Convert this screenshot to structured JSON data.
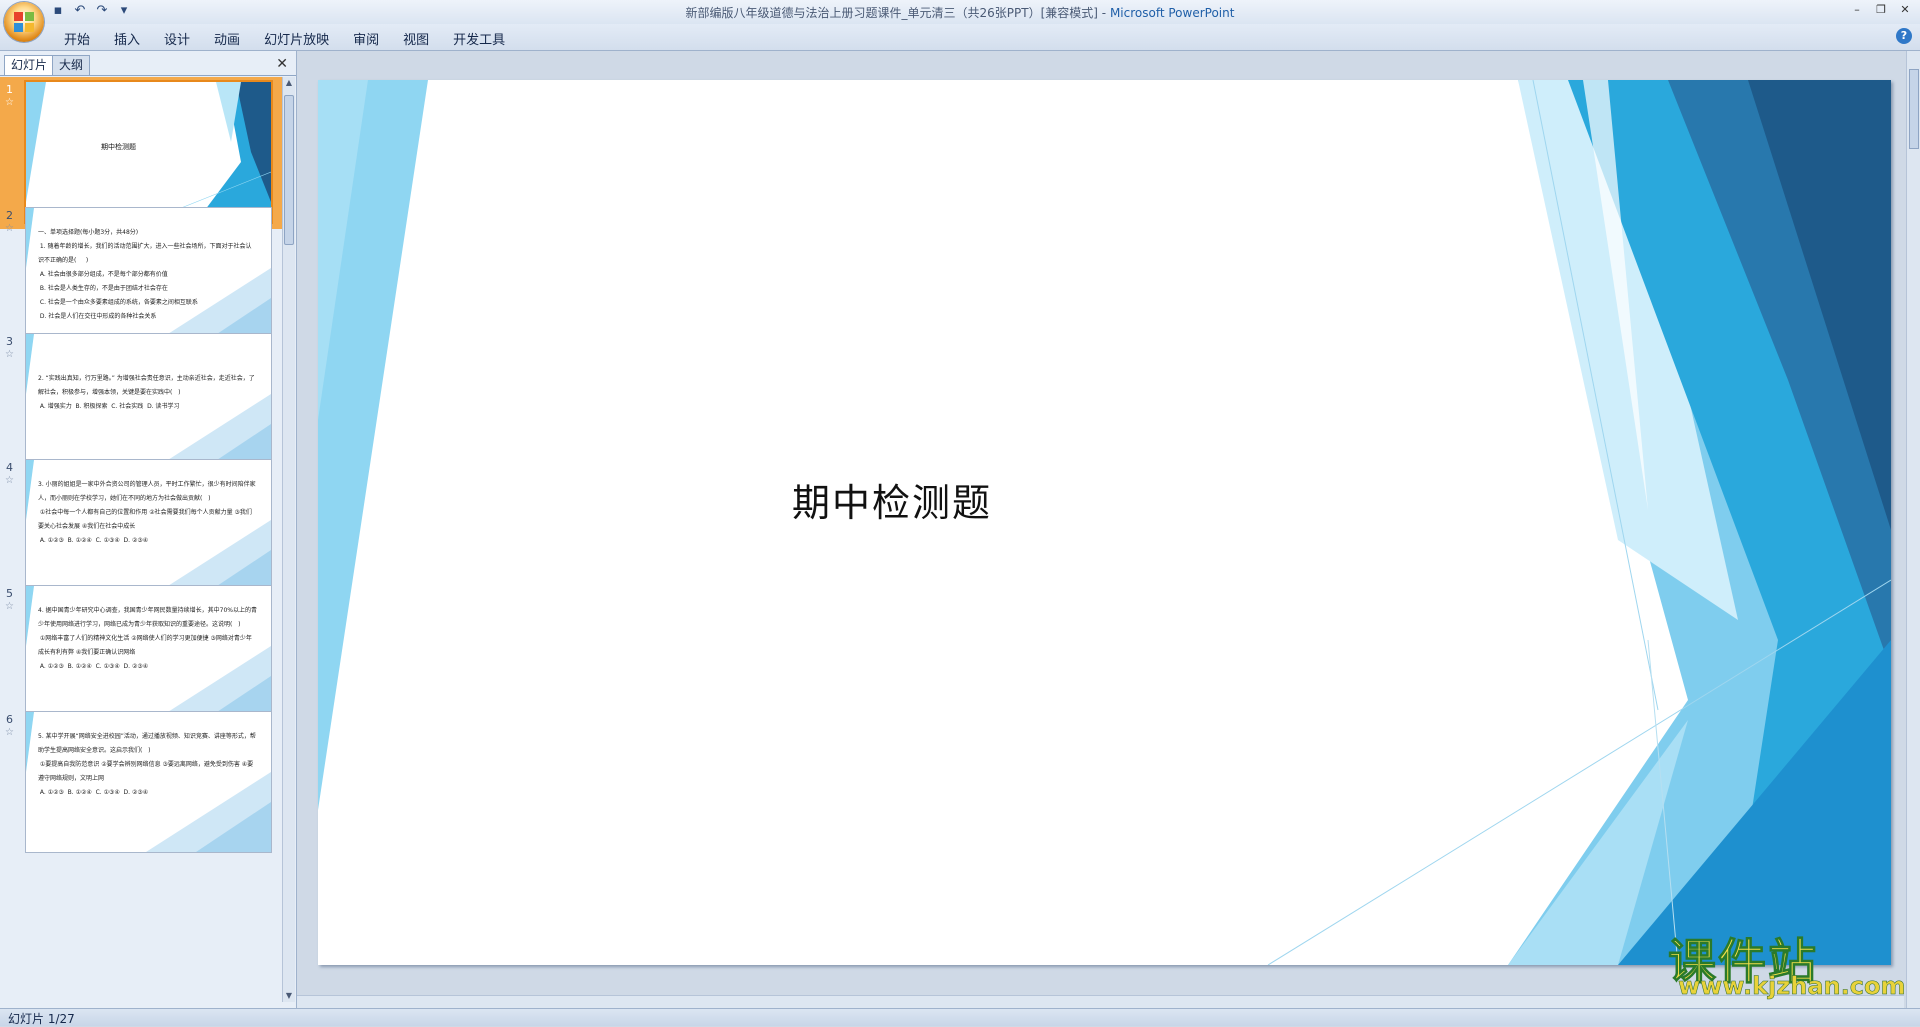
{
  "app": {
    "document_title": "新部编版八年级道德与法治上册习题课件_单元清三（共26张PPT）[兼容模式]",
    "app_name": "Microsoft PowerPoint",
    "separator": " - "
  },
  "ribbon": {
    "tabs": [
      "开始",
      "插入",
      "设计",
      "动画",
      "幻灯片放映",
      "审阅",
      "视图",
      "开发工具"
    ]
  },
  "panel": {
    "tabs": [
      "幻灯片",
      "大纲"
    ],
    "close_glyph": "✕"
  },
  "slides": [
    {
      "num": "1",
      "title": "期中检测题",
      "selected": true
    },
    {
      "num": "2",
      "text": "一、单项选择题(每小题3分，共48分)\n 1. 随着年龄的增长，我们的活动范围扩大，进入一些社会场所，下面对于社会认识不正确的是(     )\n A. 社会由很多部分组成，不是每个部分都有价值\n B. 社会是人类生存的，不是由于团结才社会存在\n C. 社会是一个由众多要素组成的系统，各要素之间相互联系\n D. 社会是人们在交往中形成的各种社会关系"
    },
    {
      "num": "3",
      "text": "2. “实践出真知，行万里路。” 为增强社会责任意识，主动亲近社会，走近社会，了解社会，积极参与，增强本领，关键是要在实践中(   )\n A. 增强实力  B. 积极探索  C. 社会实践  D. 读书学习"
    },
    {
      "num": "4",
      "text": "3. 小丽的姐姐是一家中外合资公司的管理人员，平时工作繁忙，很少有时间陪伴家人，而小丽则在学校学习，她们在不同的地方为社会做出贡献(   )\n ①社会中每一个人都有自己的位置和作用 ②社会需要我们每个人贡献力量 ③我们要关心社会发展 ④我们在社会中成长\n A. ①②③  B. ①②④  C. ①③④  D. ②③④"
    },
    {
      "num": "5",
      "text": "4. 据中国青少年研究中心调查，我国青少年网民数量持续增长，其中70%以上的青少年使用网络进行学习，网络已成为青少年获取知识的重要途径。这说明(   )\n ①网络丰富了人们的精神文化生活 ②网络使人们的学习更加便捷 ③网络对青少年成长有利有弊 ④我们要正确认识网络\n A. ①②③  B. ①②④  C. ①③④  D. ②③④"
    },
    {
      "num": "6",
      "text": "5. 某中学开展“网络安全进校园”活动，通过播放视频、知识竞赛、讲座等形式，帮助学生提高网络安全意识。这启示我们(   )\n ①要提高自我防范意识 ②要学会辨别网络信息 ③要远离网络，避免受到伤害 ④要遵守网络规则，文明上网\n A. ①②③  B. ①②④  C. ①③④  D. ②③④"
    }
  ],
  "main_slide": {
    "title": "期中检测题"
  },
  "status": {
    "slide_indicator": "幻灯片 1/27"
  },
  "watermark": {
    "brand": "课件站",
    "url": "www.kjzhan.com"
  },
  "colors": {
    "accent_light": "#8fd6f2",
    "accent_mid": "#2aa8dc",
    "accent_dark": "#1e5a8a",
    "selected_thumb": "#f4a94a"
  }
}
